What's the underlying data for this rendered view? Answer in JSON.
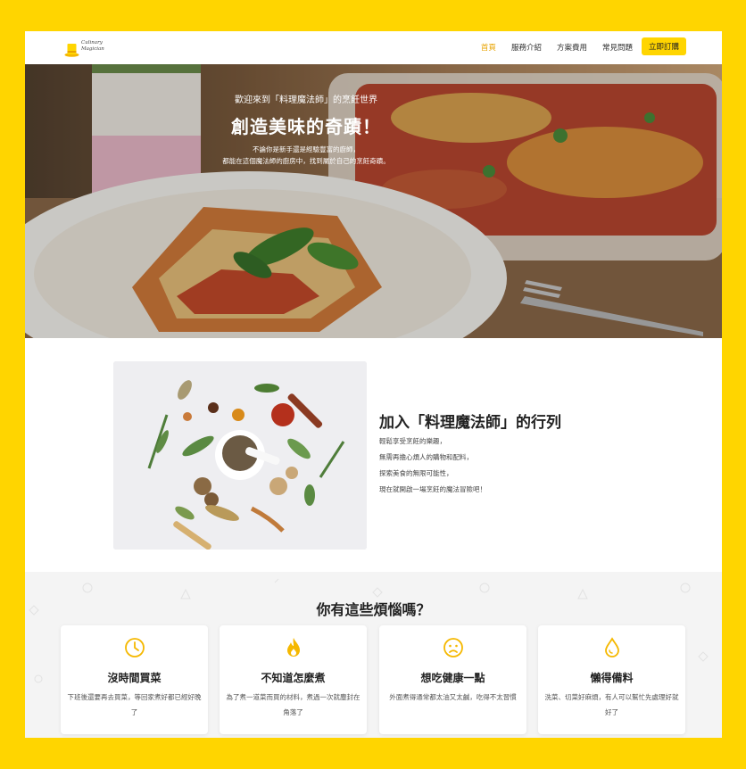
{
  "nav": {
    "logo_text_line1": "Culinary",
    "logo_text_line2": "Magician",
    "items": [
      {
        "label": "首頁",
        "active": true
      },
      {
        "label": "服務介紹",
        "active": false
      },
      {
        "label": "方案費用",
        "active": false
      },
      {
        "label": "常見問題",
        "active": false
      }
    ],
    "cta_label": "立即訂購"
  },
  "hero": {
    "tagline": "歡迎來到「料理魔法師」的烹飪世界",
    "title": "創造美味的奇蹟！",
    "subtitle_line1": "不論你是新手還是經驗豐富的廚師，",
    "subtitle_line2": "都能在這個魔法師的廚房中，找到屬於自己的烹飪奇蹟。"
  },
  "join": {
    "title": "加入「料理魔法師」的行列",
    "lines": [
      "輕鬆享受烹飪的樂趣，",
      "無需再擔心煩人的購物和配料，",
      "探索美食的無限可能性，",
      "現在就開啟一場烹飪的魔法冒險吧！"
    ]
  },
  "worries": {
    "title": "你有這些煩惱嗎？",
    "cards": [
      {
        "icon": "clock-icon",
        "title": "沒時間買菜",
        "desc": "下班後還要再去買菜，等回家煮好都已經好晚了"
      },
      {
        "icon": "flame-icon",
        "title": "不知道怎麼煮",
        "desc": "為了煮一道菜而買的材料，煮過一次就塵封在角落了"
      },
      {
        "icon": "sad-face-icon",
        "title": "想吃健康一點",
        "desc": "外面煮得通常都太油又太鹹，吃得不太習慣"
      },
      {
        "icon": "drop-icon",
        "title": "懶得備料",
        "desc": "洗菜、切菜好麻煩，有人可以幫忙先處理好就好了"
      }
    ]
  },
  "colors": {
    "brand_yellow": "#FFD500",
    "accent_icon": "#F5B800",
    "nav_active": "#E8A300"
  }
}
